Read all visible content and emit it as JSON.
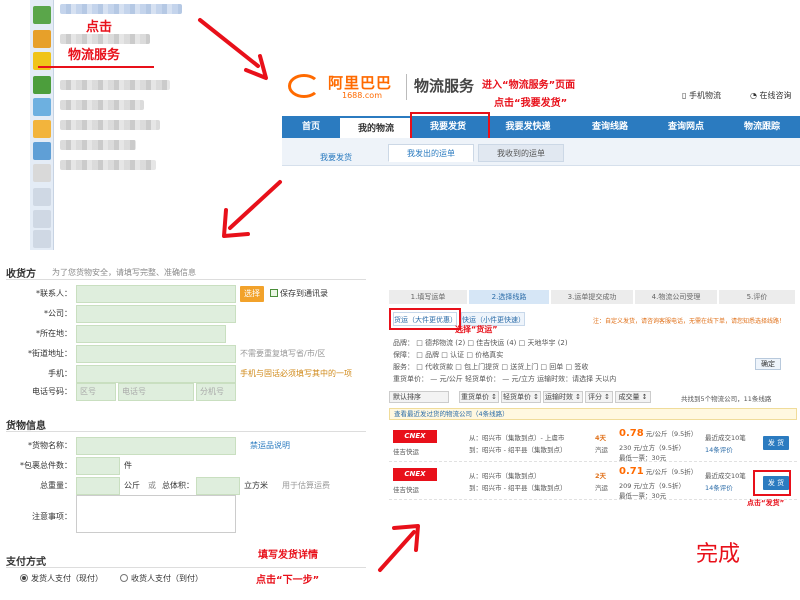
{
  "colors": {
    "accent_red": "#e8101a",
    "brand_orange": "#ff6a00",
    "nav_blue": "#2b7bc0",
    "field_green": "#dfeedd"
  },
  "step1": {
    "annotation_line1": "点击",
    "annotation_line2": "物流服务"
  },
  "portal": {
    "logo_text": "阿里巴巴",
    "logo_sub": "1688.com",
    "service_title": "物流服务",
    "mobile_link": "手机物流",
    "consult_link": "在线咨询",
    "annotation_line1": "进入“物流服务”页面",
    "annotation_line2": "点击“我要发货”",
    "nav": [
      "首页",
      "我的物流",
      "我要发货",
      "我要发快递",
      "查询线路",
      "查询网点",
      "物流跟踪"
    ],
    "sub_left": "我要发货",
    "sub_tabs": [
      "我发出的运单",
      "我收到的运单"
    ]
  },
  "form": {
    "sender_section": "收货方",
    "sender_hint": "为了您货物安全，请填写完整、准确信息",
    "contact_label": "*联系人：",
    "select_button": "选择",
    "save_address": "保存到通讯录",
    "company_label": "*公司：",
    "location_label": "*所在地：",
    "street_label": "*街道地址：",
    "street_note": "不需要重复填写省/市/区",
    "mobile_label": "手机：",
    "mobile_note": "手机与固话必须填写其中的一项",
    "phone_label": "电话号码：",
    "phone_ph_area": "区号",
    "phone_ph_number": "电话号",
    "phone_ph_ext": "分机号",
    "goods_section": "货物信息",
    "goods_name_label": "*货物名称：",
    "prohibited_link": "禁运品说明",
    "packages_label": "*包裹总件数：",
    "packages_unit": "件",
    "weight_label": "总重量：",
    "weight_unit": "公斤",
    "or_text": "或",
    "volume_label": "总体积：",
    "volume_unit": "立方米",
    "volume_note": "用于估算运费",
    "notes_label": "注意事项：",
    "payment_section": "支付方式",
    "pay_option1": "发货人支付（现付）",
    "pay_option2": "收货人支付（到付）",
    "annotation_line1": "填写发货详情",
    "annotation_line2": "点击“下一步”"
  },
  "results": {
    "steps": [
      "1.填写运单",
      "2.选择线路",
      "3.运单提交成功",
      "4.物流公司受理",
      "5.评价"
    ],
    "tab_cargo": "货运（大件更优惠）",
    "tab_express": "快运（小件更快速）",
    "tab_annotation": "选择“货运”",
    "top_notice": "注：自定义发货，请咨询客服电话，无需在线下单，请您知悉选择线路！",
    "filter_rows": [
      "品牌： □ 德邦物流 (2) □ 佳吉快运 (4) □ 天地华宇 (2)",
      "保障： □ 品牌 □ 认证 □ 价格真实",
      "服务： □ 代收货款 □ 包上门提货 □ 送货上门 □ 回单 □ 签收"
    ],
    "filter_row4": "重货单价： — 元/公斤  轻货单价： — 元/立方  运输时效：请选择  天以内",
    "confirm_button": "确定",
    "sort_default": "默认排序",
    "sort_buttons": [
      "重货单价 ↕",
      "轻货单价 ↕",
      "运输时效 ↕",
      "评分 ↕",
      "成交量 ↕"
    ],
    "count_text": "共找到5个物流公司，11条线路",
    "recent_notice": "查看最近发过货的物流公司（4条线路）",
    "rows": [
      {
        "carrier": "CNEX",
        "carrier_sub": "佳吉快运",
        "from": "从：昭兴市（集散到点）- 上虞市",
        "to": "到：昭兴市 - 绍平县（集散到点）",
        "days": "4天",
        "mode": "汽运",
        "heavy_price": "0.78",
        "heavy_unit": "元/公斤（9.5折）",
        "light_price": "230 元/立方（9.5折）",
        "min_fee": "最低一票：30元",
        "deals": "最近成交10笔",
        "reviews": "14条评价",
        "ship_button": "发 货"
      },
      {
        "carrier": "CNEX",
        "carrier_sub": "佳吉快运",
        "from": "从：昭兴市（集散到点）",
        "to": "到：昭兴市 - 绍平县（集散到点）",
        "days": "2天",
        "mode": "汽运",
        "heavy_price": "0.71",
        "heavy_unit": "元/公斤（9.5折）",
        "light_price": "209 元/立方（9.5折）",
        "min_fee": "最低一票：30元",
        "deals": "最近成交10笔",
        "reviews": "14条评价",
        "ship_button": "发 货"
      }
    ],
    "ship_annotation": "点击“发货”"
  },
  "done_text": "完成"
}
